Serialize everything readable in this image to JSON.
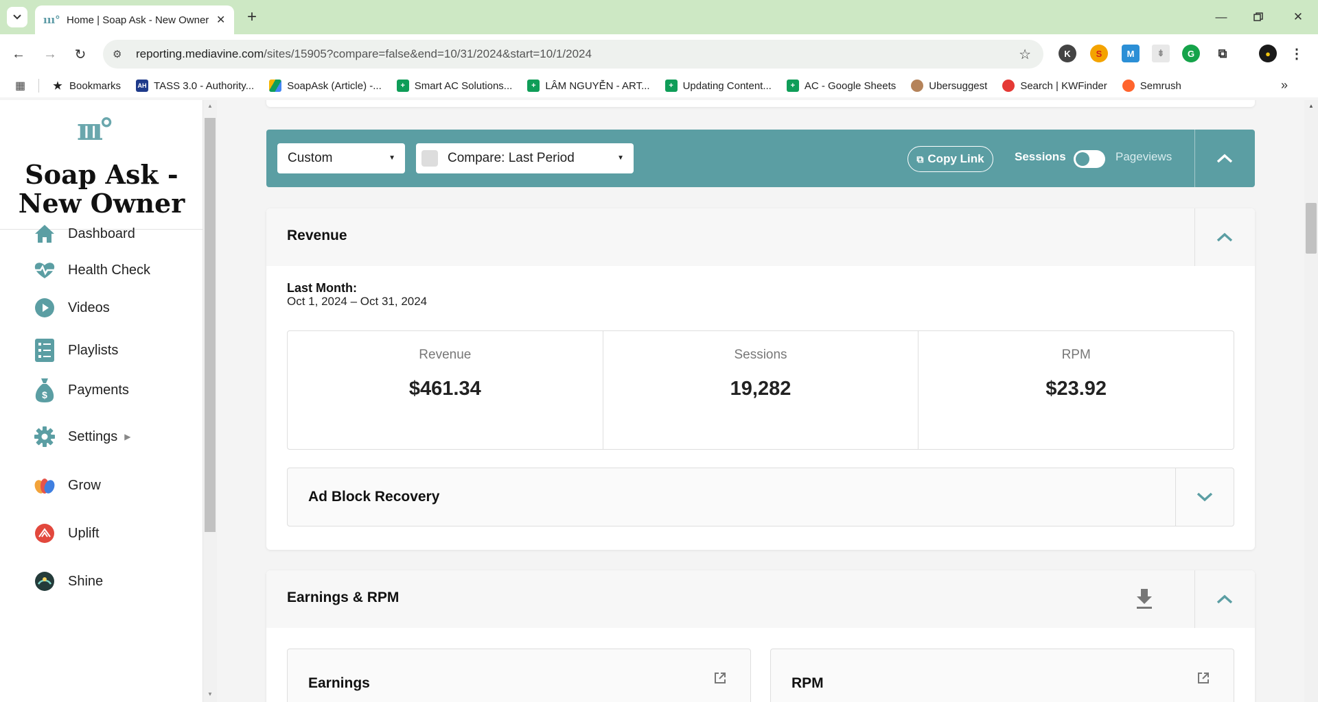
{
  "browser": {
    "tab_title": "Home | Soap Ask - New Owner",
    "url_host": "reporting.mediavine.com",
    "url_path": "/sites/15905?compare=false&end=10/31/2024&start=10/1/2024",
    "bookmarks": [
      {
        "label": "Bookmarks",
        "icon": "star-icon"
      },
      {
        "label": "TASS 3.0 - Authority...",
        "icon": "ah-icon"
      },
      {
        "label": "SoapAsk (Article) -...",
        "icon": "google-drive-icon"
      },
      {
        "label": "Smart AC Solutions...",
        "icon": "google-sheets-icon"
      },
      {
        "label": "LÂM NGUYỄN - ART...",
        "icon": "google-sheets-icon"
      },
      {
        "label": "Updating Content...",
        "icon": "google-sheets-icon"
      },
      {
        "label": "AC - Google Sheets",
        "icon": "google-sheets-icon"
      },
      {
        "label": "Ubersuggest",
        "icon": "ubersuggest-icon"
      },
      {
        "label": "Search | KWFinder",
        "icon": "kwfinder-icon"
      },
      {
        "label": "Semrush",
        "icon": "semrush-icon"
      }
    ]
  },
  "sidebar": {
    "site_name_line1": "Soap Ask -",
    "site_name_line2": "New Owner",
    "items": [
      {
        "label": "Dashboard",
        "icon": "home-icon"
      },
      {
        "label": "Health Check",
        "icon": "heartbeat-icon"
      },
      {
        "label": "Videos",
        "icon": "play-icon"
      },
      {
        "label": "Playlists",
        "icon": "list-icon"
      },
      {
        "label": "Payments",
        "icon": "money-bag-icon"
      },
      {
        "label": "Settings",
        "icon": "gear-icon"
      },
      {
        "label": "Grow",
        "icon": "grow-icon"
      },
      {
        "label": "Uplift",
        "icon": "uplift-icon"
      },
      {
        "label": "Shine",
        "icon": "shine-icon"
      }
    ]
  },
  "filters": {
    "range_select": "Custom",
    "compare_select": "Compare: Last Period",
    "copy_link": "Copy Link",
    "toggle_left": "Sessions",
    "toggle_right": "Pageviews"
  },
  "revenue": {
    "title": "Revenue",
    "period_label": "Last Month:",
    "period_range": "Oct 1, 2024 – Oct 31, 2024",
    "stats": [
      {
        "label": "Revenue",
        "value": "$461.34"
      },
      {
        "label": "Sessions",
        "value": "19,282"
      },
      {
        "label": "RPM",
        "value": "$23.92"
      }
    ],
    "ad_block": "Ad Block Recovery"
  },
  "earnings": {
    "title": "Earnings & RPM",
    "cards": [
      {
        "title": "Earnings"
      },
      {
        "title": "RPM"
      }
    ]
  },
  "colors": {
    "accent": "#5b9ea3",
    "tabbar": "#cde8c4"
  }
}
